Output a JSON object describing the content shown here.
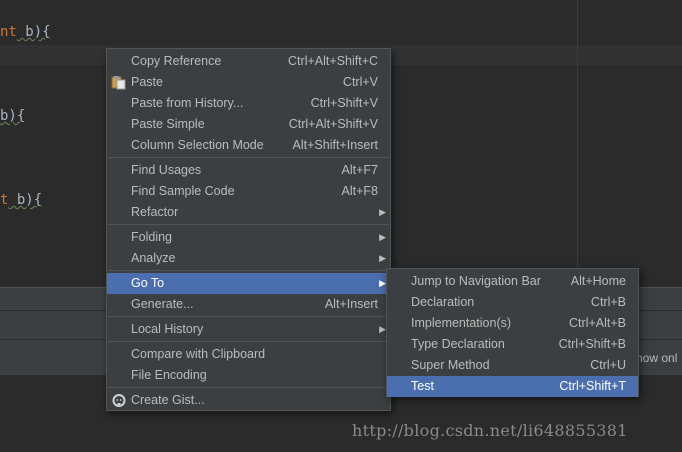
{
  "editor": {
    "lines": [
      {
        "kw": "nt",
        "rest": " b){"
      },
      {
        "kw": "",
        "rest": "b){"
      },
      {
        "kw": "t",
        "rest": " b){"
      }
    ]
  },
  "context_menu": {
    "items": [
      {
        "label": "Copy Reference",
        "shortcut": "Ctrl+Alt+Shift+C"
      },
      {
        "label": "Paste",
        "shortcut": "Ctrl+V"
      },
      {
        "label": "Paste from History...",
        "shortcut": "Ctrl+Shift+V"
      },
      {
        "label": "Paste Simple",
        "shortcut": "Ctrl+Alt+Shift+V"
      },
      {
        "label": "Column Selection Mode",
        "shortcut": "Alt+Shift+Insert"
      },
      {
        "label": "Find Usages",
        "shortcut": "Alt+F7"
      },
      {
        "label": "Find Sample Code",
        "shortcut": "Alt+F8"
      },
      {
        "label": "Refactor",
        "shortcut": ""
      },
      {
        "label": "Folding",
        "shortcut": ""
      },
      {
        "label": "Analyze",
        "shortcut": ""
      },
      {
        "label": "Go To",
        "shortcut": ""
      },
      {
        "label": "Generate...",
        "shortcut": "Alt+Insert"
      },
      {
        "label": "Local History",
        "shortcut": ""
      },
      {
        "label": "Compare with Clipboard",
        "shortcut": ""
      },
      {
        "label": "File Encoding",
        "shortcut": ""
      },
      {
        "label": "Create Gist...",
        "shortcut": ""
      }
    ]
  },
  "goto_submenu": {
    "items": [
      {
        "label": "Jump to Navigation Bar",
        "shortcut": "Alt+Home"
      },
      {
        "label": "Declaration",
        "shortcut": "Ctrl+B"
      },
      {
        "label": "Implementation(s)",
        "shortcut": "Ctrl+Alt+B"
      },
      {
        "label": "Type Declaration",
        "shortcut": "Ctrl+Shift+B"
      },
      {
        "label": "Super Method",
        "shortcut": "Ctrl+U"
      },
      {
        "label": "Test",
        "shortcut": "Ctrl+Shift+T"
      }
    ]
  },
  "panel": {
    "show_only_label": "how onl"
  },
  "watermark": "http://blog.csdn.net/li648855381",
  "colors": {
    "selection": "#4b6eaf",
    "menu_bg": "#3c3f41",
    "editor_bg": "#2b2b2b",
    "keyword": "#cc7832"
  }
}
